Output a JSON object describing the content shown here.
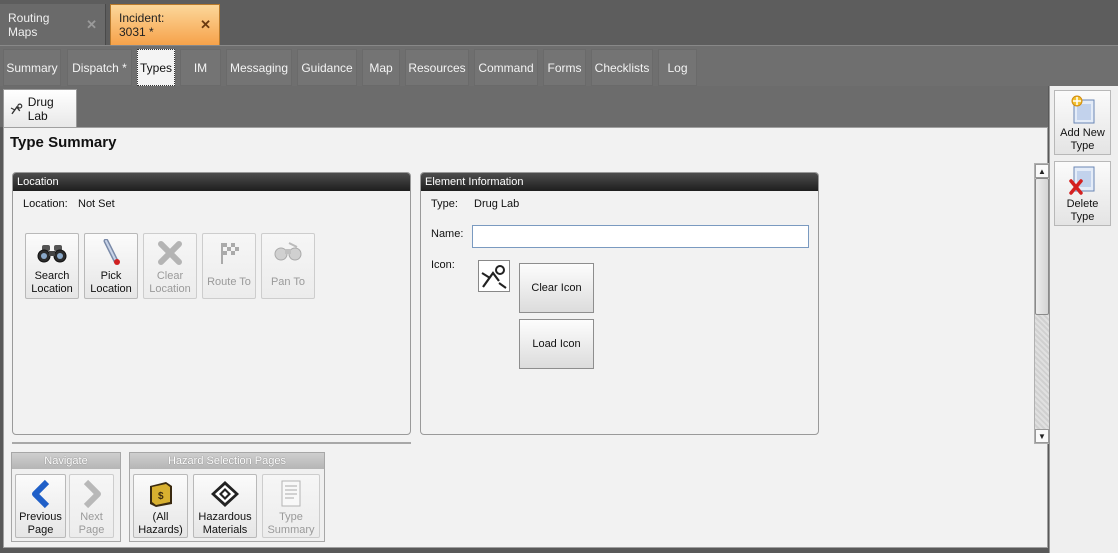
{
  "doc_tabs": [
    {
      "label": "Routing Maps",
      "close": "✕"
    },
    {
      "label": "Incident: 3031 *",
      "close": "✕"
    }
  ],
  "nav_tabs": [
    "Summary",
    "Dispatch *",
    "Types",
    "IM",
    "Messaging",
    "Guidance",
    "Map",
    "Resources",
    "Command",
    "Forms",
    "Checklists",
    "Log"
  ],
  "element_tab": {
    "label": "Drug Lab"
  },
  "page_title": "Type Summary",
  "location_panel": {
    "title": "Location",
    "location_label": "Location:",
    "location_value": "Not Set",
    "buttons": {
      "search": "Search Location",
      "pick": "Pick Location",
      "clear": "Clear Location",
      "route": "Route To",
      "pan": "Pan To"
    }
  },
  "element_panel": {
    "title": "Element Information",
    "type_label": "Type:",
    "type_value": "Drug Lab",
    "name_label": "Name:",
    "name_value": "",
    "icon_label": "Icon:",
    "clear_icon": "Clear Icon",
    "load_icon": "Load Icon"
  },
  "navigate": {
    "title": "Navigate",
    "previous": "Previous Page",
    "next": "Next Page"
  },
  "hazard_pages": {
    "title": "Hazard Selection Pages",
    "all": "(All Hazards)",
    "materials": "Hazardous Materials",
    "summary": "Type Summary"
  },
  "sidebar": {
    "add": "Add New Type",
    "delete": "Delete Type"
  },
  "colors": {
    "active_doc_tab": "#f6a24a",
    "panel_header": "#1e1e1e",
    "navigate_arrow": "#1f5fc8"
  }
}
